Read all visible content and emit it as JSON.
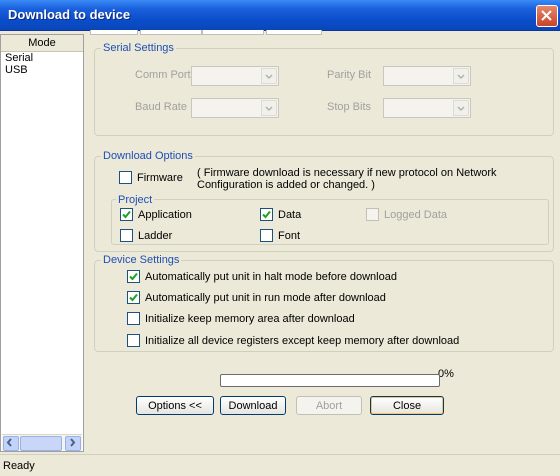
{
  "window": {
    "title": "Download to device"
  },
  "mode_list": {
    "header": "Mode",
    "items": [
      "Serial",
      "USB"
    ]
  },
  "serial_settings": {
    "legend": "Serial Settings",
    "comm_port": "Comm Port",
    "parity_bit": "Parity Bit",
    "baud_rate": "Baud Rate",
    "stop_bits": "Stop Bits"
  },
  "download_options": {
    "legend": "Download Options",
    "firmware": "Firmware",
    "firmware_note": "( Firmware download is necessary if new protocol on Network Configuration is added or changed. )",
    "project": {
      "legend": "Project",
      "application": "Application",
      "data": "Data",
      "logged_data": "Logged Data",
      "ladder": "Ladder",
      "font": "Font"
    }
  },
  "device_settings": {
    "legend": "Device Settings",
    "items": [
      "Automatically put unit in halt mode before download",
      "Automatically put unit in run mode after download",
      "Initialize keep memory area after download",
      "Initialize all device registers except keep memory after download"
    ]
  },
  "progress": {
    "percent_label": "0%",
    "value": 0
  },
  "buttons": {
    "options": "Options <<",
    "download": "Download",
    "abort": "Abort",
    "close": "Close"
  },
  "status": {
    "text": "Ready"
  }
}
